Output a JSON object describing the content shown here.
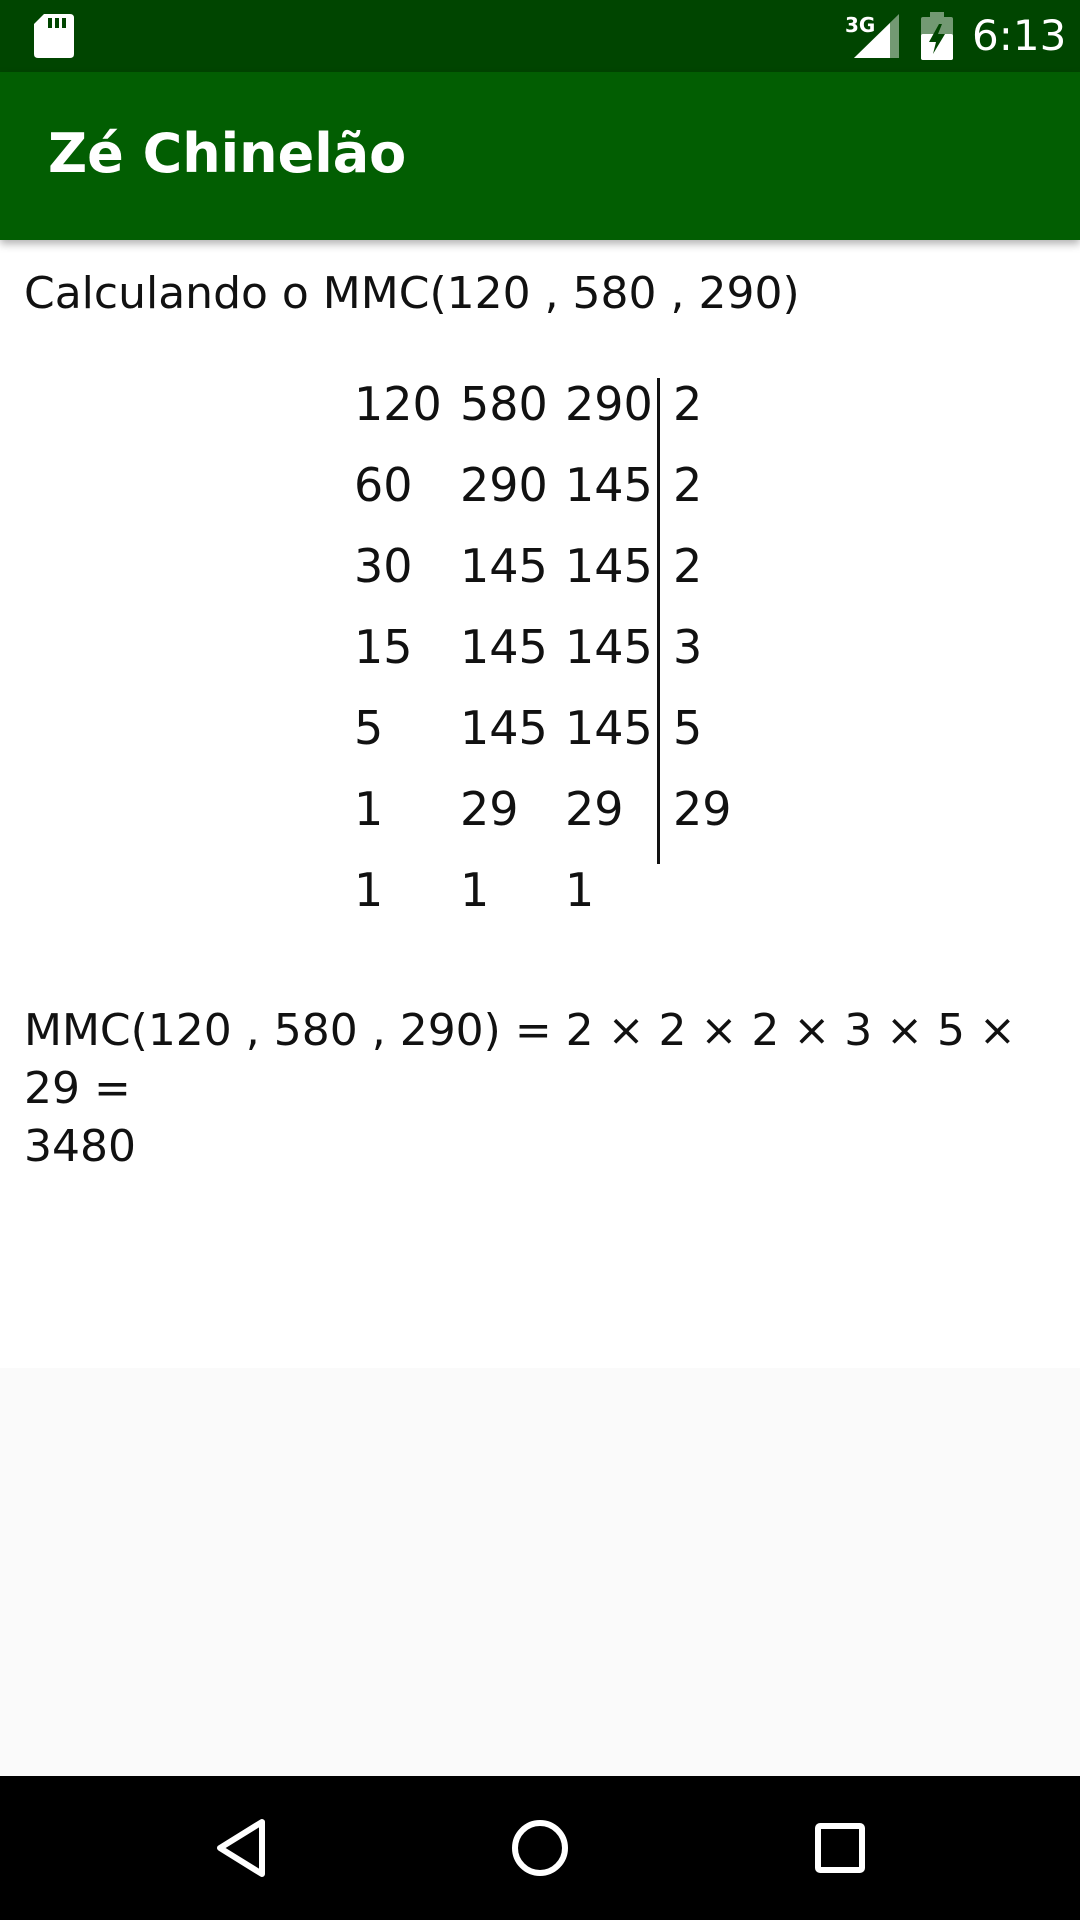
{
  "status_bar": {
    "network": "3G",
    "time": "6:13",
    "icons": [
      "sd-card-icon",
      "signal-icon",
      "battery-charging-icon"
    ]
  },
  "app_bar": {
    "title": "Zé Chinelão"
  },
  "main": {
    "heading": "Calculando o MMC(120 , 580 , 290)",
    "division_rows": [
      {
        "n1": "120",
        "n2": "580",
        "n3": "290",
        "divisor": "2"
      },
      {
        "n1": "60",
        "n2": "290",
        "n3": "145",
        "divisor": "2"
      },
      {
        "n1": "30",
        "n2": "145",
        "n3": "145",
        "divisor": "2"
      },
      {
        "n1": "15",
        "n2": "145",
        "n3": "145",
        "divisor": "3"
      },
      {
        "n1": "5",
        "n2": "145",
        "n3": "145",
        "divisor": "5"
      },
      {
        "n1": "1",
        "n2": "29",
        "n3": "29",
        "divisor": "29"
      },
      {
        "n1": "1",
        "n2": "1",
        "n3": "1",
        "divisor": ""
      }
    ],
    "result_line1": "MMC(120 , 580 , 290) = 2 × 2 × 2 × 3 × 5 × 29 =",
    "result_line2": "3480"
  },
  "nav_bar": {
    "buttons": [
      "back-icon",
      "home-icon",
      "recents-icon"
    ]
  },
  "colors": {
    "status_bar": "#004500",
    "app_bar": "#025e02",
    "text": "#111111",
    "background": "#fafafa"
  }
}
